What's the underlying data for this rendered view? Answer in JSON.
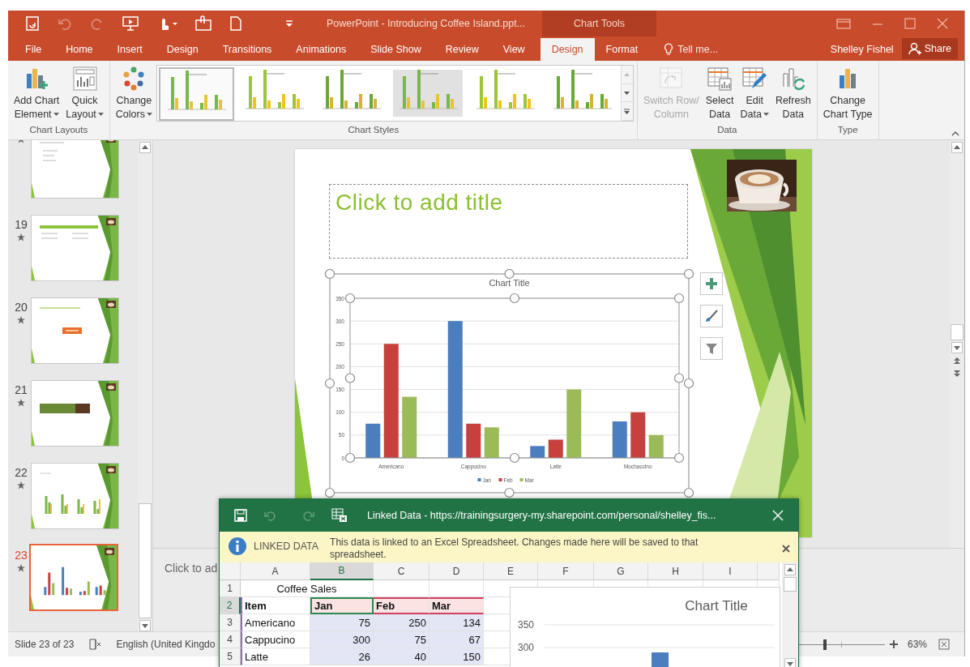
{
  "window": {
    "title": "PowerPoint - Introducing Coffee Island.ppt...",
    "context_label": "Chart Tools"
  },
  "tabs": [
    {
      "label": "File",
      "selected": false,
      "kind": "core"
    },
    {
      "label": "Home",
      "selected": false,
      "kind": "core"
    },
    {
      "label": "Insert",
      "selected": false,
      "kind": "core"
    },
    {
      "label": "Design",
      "selected": false,
      "kind": "core"
    },
    {
      "label": "Transitions",
      "selected": false,
      "kind": "core"
    },
    {
      "label": "Animations",
      "selected": false,
      "kind": "core"
    },
    {
      "label": "Slide Show",
      "selected": false,
      "kind": "core"
    },
    {
      "label": "Review",
      "selected": false,
      "kind": "core"
    },
    {
      "label": "View",
      "selected": false,
      "kind": "core"
    },
    {
      "label": "Design",
      "selected": true,
      "kind": "context"
    },
    {
      "label": "Format",
      "selected": false,
      "kind": "context"
    }
  ],
  "tell_me": "Tell me...",
  "account": {
    "user": "Shelley Fishel",
    "share": "Share"
  },
  "ribbon": [
    {
      "label": "Chart Layouts",
      "buttons": [
        {
          "lines": [
            "Add Chart",
            "Element"
          ],
          "kind": "add-chart",
          "dropdown": true,
          "disabled": false
        },
        {
          "lines": [
            "Quick",
            "Layout"
          ],
          "kind": "layout",
          "dropdown": true,
          "disabled": false
        }
      ]
    },
    {
      "label": "Chart Styles",
      "buttons": [
        {
          "lines": [
            "Change",
            "Colors"
          ],
          "kind": "colors",
          "dropdown": true,
          "disabled": false
        }
      ],
      "styles": [
        {
          "selected": true
        },
        {
          "selected": false
        },
        {
          "selected": false
        },
        {
          "selected": false
        },
        {
          "selected": false
        },
        {
          "selected": false
        }
      ]
    },
    {
      "label": "Data",
      "buttons": [
        {
          "lines": [
            "Switch Row/",
            "Column"
          ],
          "kind": "switch",
          "dropdown": false,
          "disabled": true
        },
        {
          "lines": [
            "Select",
            "Data"
          ],
          "kind": "select-data",
          "dropdown": false,
          "disabled": false
        },
        {
          "lines": [
            "Edit",
            "Data"
          ],
          "kind": "edit-data",
          "dropdown": true,
          "disabled": false
        },
        {
          "lines": [
            "Refresh",
            "Data"
          ],
          "kind": "refresh",
          "dropdown": false,
          "disabled": false
        }
      ]
    },
    {
      "label": "Type",
      "buttons": [
        {
          "lines": [
            "Change",
            "Chart Type"
          ],
          "kind": "chart-type",
          "dropdown": false,
          "disabled": false
        }
      ]
    }
  ],
  "slides": [
    {
      "kind": "text",
      "selected": false,
      "animated": true
    },
    {
      "number": "19",
      "kind": "table",
      "selected": false,
      "animated": true
    },
    {
      "number": "20",
      "kind": "callout",
      "selected": false,
      "animated": true
    },
    {
      "number": "21",
      "kind": "banner",
      "selected": false,
      "animated": true
    },
    {
      "number": "22",
      "kind": "bars",
      "selected": false,
      "animated": true
    },
    {
      "number": "23",
      "kind": "color-bars",
      "selected": true,
      "animated": true
    }
  ],
  "slide": {
    "title_placeholder": "Click to add title",
    "chart": {
      "chart_data": {
        "type": "bar",
        "title": "Chart Title",
        "categories": [
          "Americano",
          "Cappucino",
          "Latte",
          "Mochaccino"
        ],
        "series": [
          {
            "name": "Jan",
            "color": "#4a7ebf",
            "values": [
              75,
              300,
              26,
              80
            ]
          },
          {
            "name": "Feb",
            "color": "#c6403d",
            "values": [
              250,
              75,
              40,
              100
            ]
          },
          {
            "name": "Mar",
            "color": "#9bbb59",
            "values": [
              134,
              67,
              150,
              50
            ]
          }
        ],
        "ylim": [
          0,
          350
        ],
        "yticks": [
          0,
          50,
          100,
          150,
          200,
          250,
          300,
          350
        ],
        "grid": true,
        "legend": "bottom"
      }
    }
  },
  "notes": "Click to ad",
  "status": {
    "slide": "Slide 23 of 23",
    "language": "English (United Kingdo",
    "zoom": {
      "label": "63%",
      "level": 0.3
    }
  },
  "linked_data": {
    "title": "Linked Data - https://trainingsurgery-my.sharepoint.com/personal/shelley_fis...",
    "info": {
      "label": "LINKED DATA",
      "message": "This data is linked to an Excel Spreadsheet.  Changes made here will be saved to that spreadsheet."
    },
    "columns": [
      {
        "label": "A",
        "selected": false
      },
      {
        "label": "B",
        "selected": true
      },
      {
        "label": "C",
        "selected": false
      },
      {
        "label": "D",
        "selected": false
      },
      {
        "label": "E",
        "selected": false
      },
      {
        "label": "F",
        "selected": false
      },
      {
        "label": "G",
        "selected": false
      },
      {
        "label": "H",
        "selected": false
      },
      {
        "label": "I",
        "selected": false
      }
    ],
    "rows": [
      {
        "number": "1",
        "selected": false,
        "kind": "title",
        "cells": [
          "Coffee Sales"
        ]
      },
      {
        "number": "2",
        "selected": true,
        "kind": "header",
        "cells": [
          "Item",
          "Jan",
          "Feb",
          "Mar"
        ]
      },
      {
        "number": "3",
        "selected": false,
        "kind": "data",
        "cells": [
          "Americano",
          "75",
          "250",
          "134"
        ]
      },
      {
        "number": "4",
        "selected": false,
        "kind": "data",
        "cells": [
          "Cappucino",
          "300",
          "75",
          "67"
        ]
      },
      {
        "number": "5",
        "selected": false,
        "kind": "data",
        "cells": [
          "Latte",
          "26",
          "40",
          "150"
        ]
      }
    ],
    "mini_chart": {
      "title": "Chart Title",
      "labels": [
        "350",
        "300"
      ]
    }
  }
}
